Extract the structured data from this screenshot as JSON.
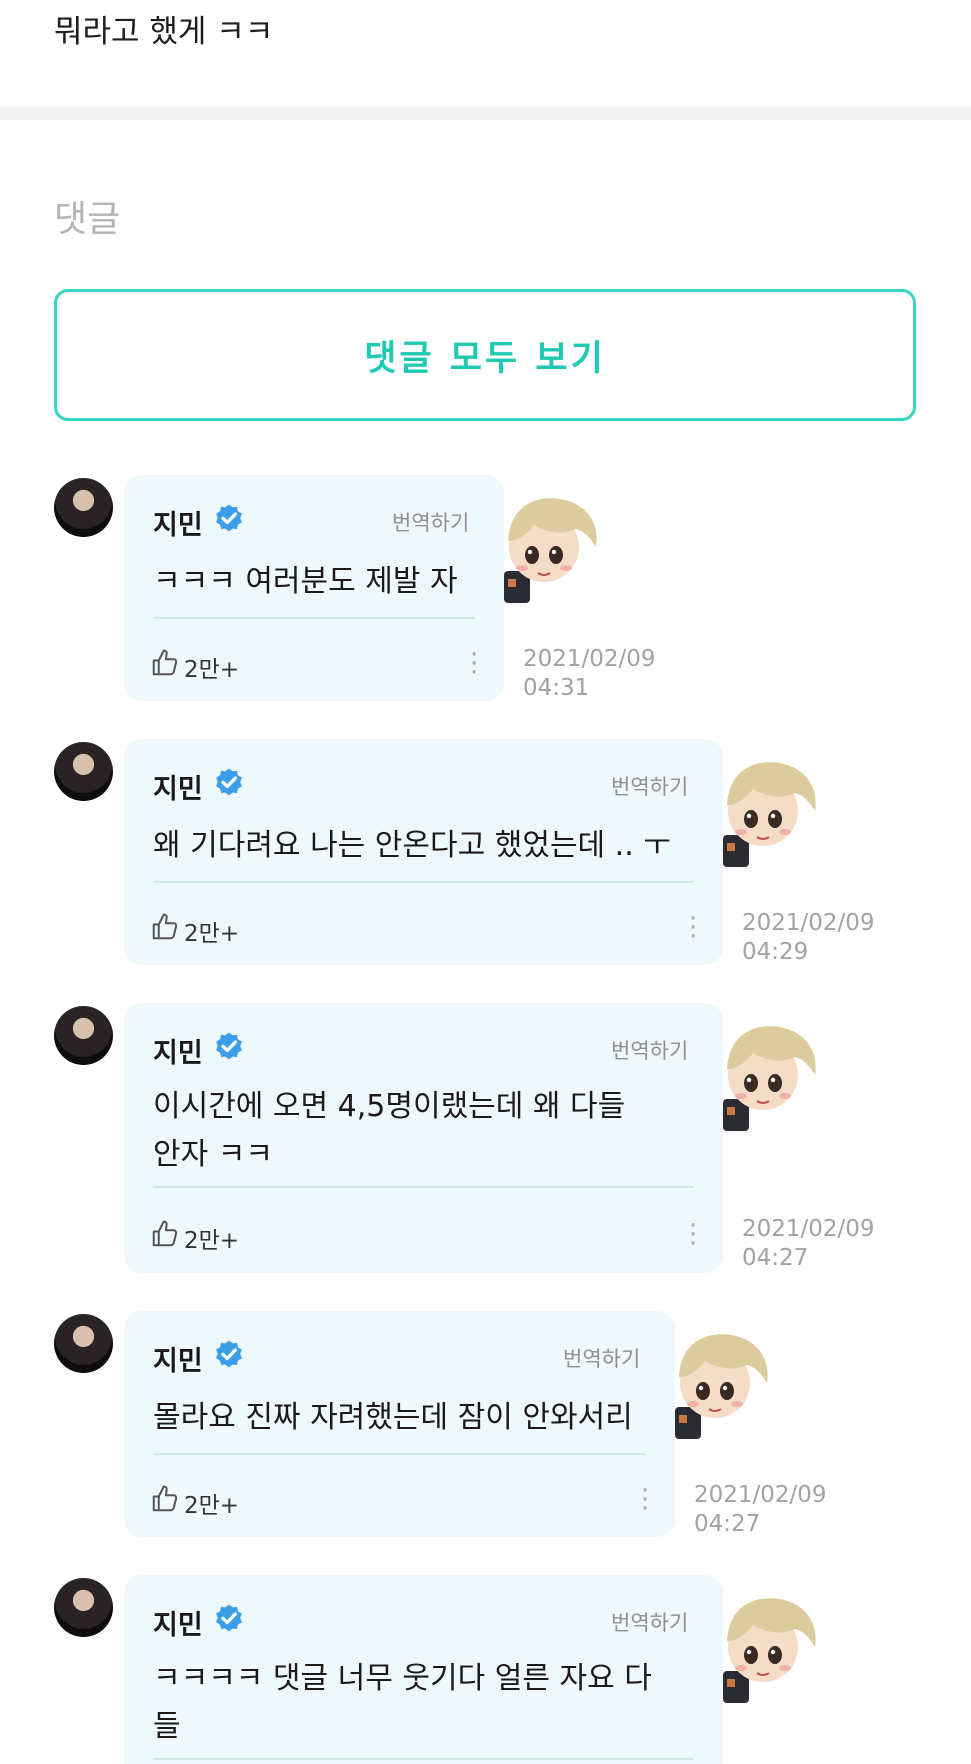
{
  "post": {
    "text": "뭐라고 했게 ㅋㅋ"
  },
  "comments_section": {
    "title": "댓글",
    "view_all_label": "댓글 모두 보기"
  },
  "comments": [
    {
      "author": "지민",
      "translate_label": "번역하기",
      "text": "ㅋㅋㅋ 여러분도 제발 자",
      "likes": "2만+",
      "date": "2021/02/09",
      "time": "04:31"
    },
    {
      "author": "지민",
      "translate_label": "번역하기",
      "text": "왜 기다려요 나는 안온다고 했었는데 .. ㅜ",
      "likes": "2만+",
      "date": "2021/02/09",
      "time": "04:29"
    },
    {
      "author": "지민",
      "translate_label": "번역하기",
      "text": "이시간에 오면 4,5명이랬는데 왜 다들 안자 ㅋㅋ",
      "likes": "2만+",
      "date": "2021/02/09",
      "time": "04:27"
    },
    {
      "author": "지민",
      "translate_label": "번역하기",
      "text": "몰라요 진짜 자려했는데 잠이 안와서리",
      "likes": "2만+",
      "date": "2021/02/09",
      "time": "04:27"
    },
    {
      "author": "지민",
      "translate_label": "번역하기",
      "text": "ㅋㅋㅋㅋ 댓글 너무 웃기다 얼른 자요 다들",
      "likes": "",
      "date": "",
      "time": ""
    }
  ],
  "colors": {
    "accent": "#1fc9b4",
    "bubble": "#eef9fd",
    "verified": "#3d9ee8"
  },
  "icons": {
    "verified": "verified-badge-icon",
    "like": "thumbs-up-icon",
    "more": "more-vertical-icon",
    "sticker": "blonde-character-sticker"
  }
}
